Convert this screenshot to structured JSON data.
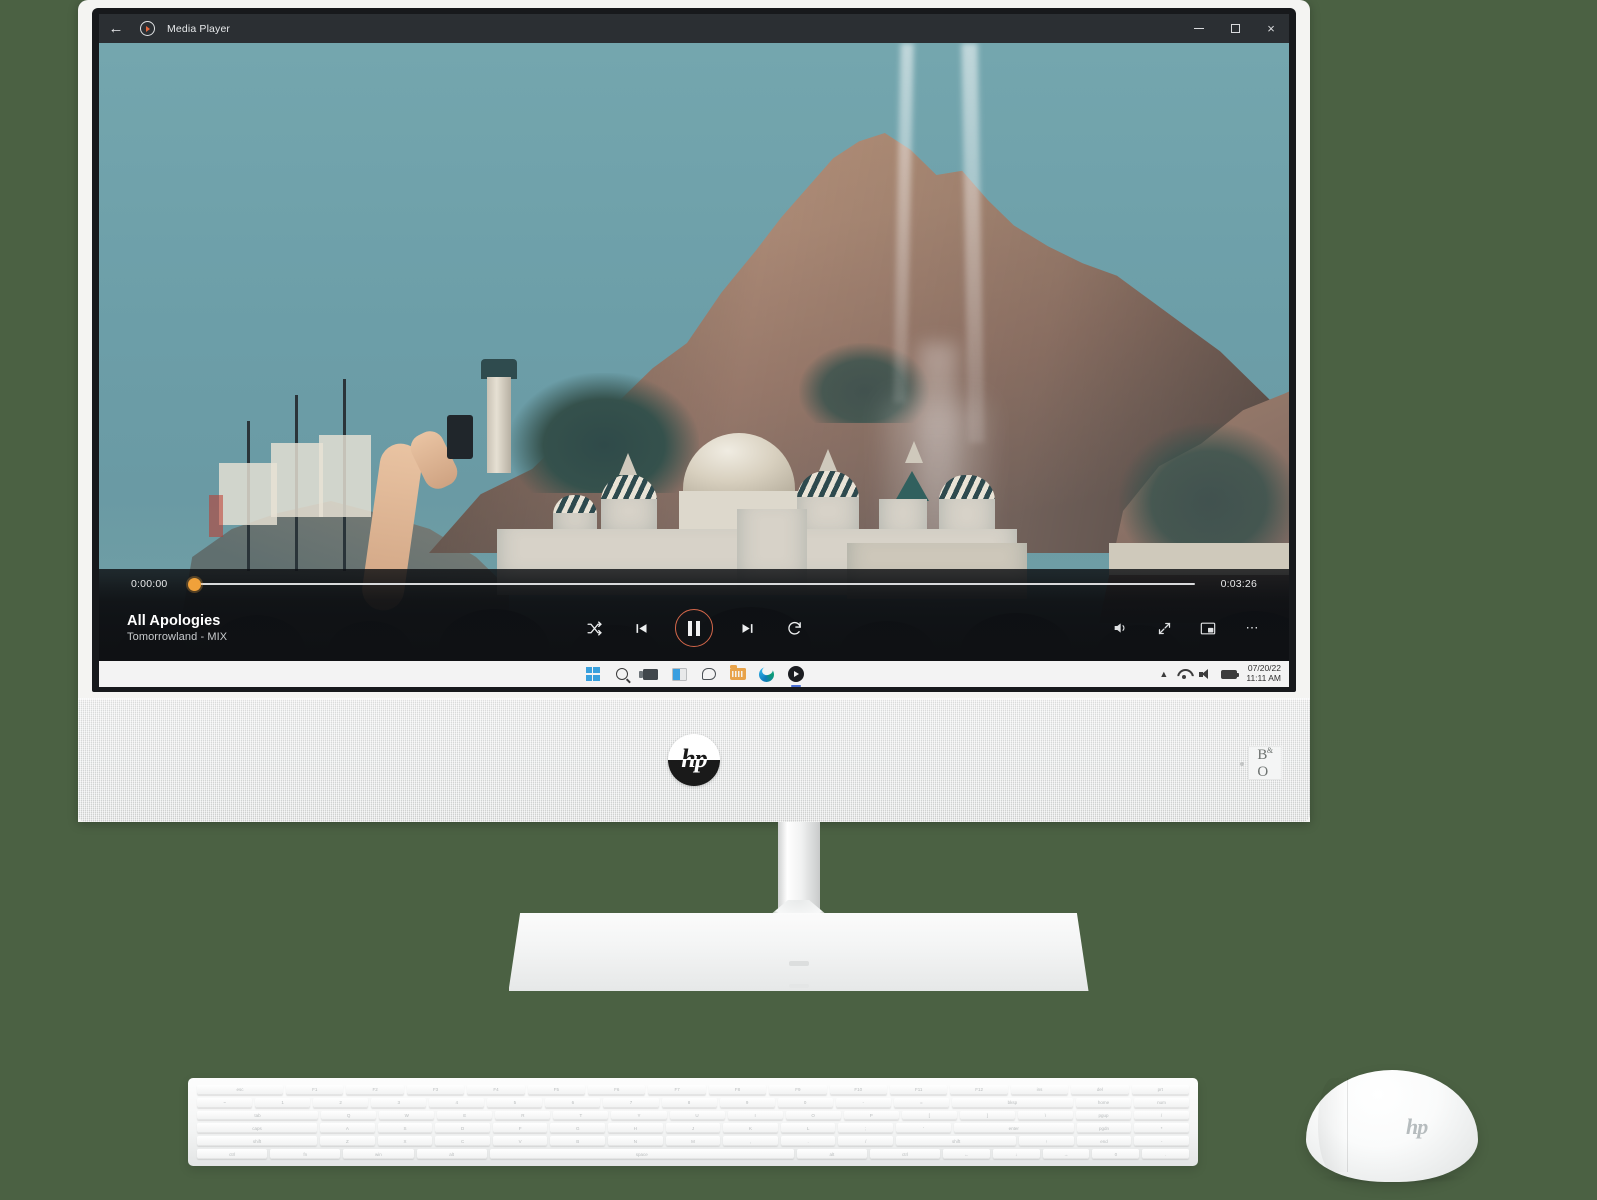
{
  "window": {
    "app_title": "Media Player",
    "back_icon": "back-arrow-icon",
    "app_icon": "media-player-logo-icon",
    "minimize_label": "",
    "maximize_label": "",
    "close_label": "×"
  },
  "player": {
    "elapsed_time": "0:00:00",
    "total_time": "0:03:26",
    "progress_percent": 0,
    "track_title": "All Apologies",
    "track_subtitle": "Tomorrowland - MIX",
    "shuffle_icon": "shuffle-icon",
    "previous_icon": "previous-track-icon",
    "play_pause_state": "pause",
    "next_icon": "next-track-icon",
    "repeat_icon": "repeat-icon",
    "volume_icon": "volume-icon",
    "fullscreen_icon": "fullscreen-icon",
    "miniplayer_icon": "mini-player-icon",
    "more_icon": "more-options-icon",
    "accent_color": "#f0a13a",
    "play_ring_color": "#d4674a"
  },
  "taskbar": {
    "items": [
      {
        "name": "start-button",
        "icon": "windows-logo-icon",
        "active": false
      },
      {
        "name": "search-button",
        "icon": "search-icon",
        "active": false
      },
      {
        "name": "task-view-button",
        "icon": "task-view-icon",
        "active": false
      },
      {
        "name": "widgets-button",
        "icon": "widgets-icon",
        "active": false
      },
      {
        "name": "chat-button",
        "icon": "chat-icon",
        "active": false
      },
      {
        "name": "file-explorer-button",
        "icon": "folder-icon",
        "active": false
      },
      {
        "name": "edge-button",
        "icon": "edge-browser-icon",
        "active": false
      },
      {
        "name": "media-player-button",
        "icon": "media-player-icon",
        "active": true
      }
    ],
    "tray": {
      "overflow_icon": "chevron-up-icon",
      "network_icon": "wifi-icon",
      "volume_icon": "speaker-icon",
      "battery_icon": "battery-icon",
      "date": "07/20/22",
      "time": "11:11 AM"
    }
  },
  "hardware": {
    "brand_logo": "hp",
    "audio_brand_line1": "B",
    "audio_brand_amp": "&",
    "audio_brand_line2": "O",
    "mouse_logo": "hp",
    "chassis_color": "#f4f4f2",
    "speaker_fabric_color": "#e6e8e8",
    "background_color": "#4b6143"
  },
  "keyboard": {
    "rows": [
      [
        "esc",
        "F1",
        "F2",
        "F3",
        "F4",
        "F5",
        "F6",
        "F7",
        "F8",
        "F9",
        "F10",
        "F11",
        "F12",
        "ins",
        "del",
        "prt"
      ],
      [
        "~",
        "1",
        "2",
        "3",
        "4",
        "5",
        "6",
        "7",
        "8",
        "9",
        "0",
        "-",
        "=",
        "bksp",
        "home",
        "num"
      ],
      [
        "tab",
        "Q",
        "W",
        "E",
        "R",
        "T",
        "Y",
        "U",
        "I",
        "O",
        "P",
        "[",
        "]",
        "\\",
        "pgup",
        "/"
      ],
      [
        "caps",
        "A",
        "S",
        "D",
        "F",
        "G",
        "H",
        "J",
        "K",
        "L",
        ";",
        "'",
        "enter",
        "pgdn",
        "*"
      ],
      [
        "shift",
        "Z",
        "X",
        "C",
        "V",
        "B",
        "N",
        "M",
        ",",
        ".",
        "/",
        "shift",
        "↑",
        "end",
        "-"
      ],
      [
        "ctrl",
        "fn",
        "win",
        "alt",
        "space",
        "alt",
        "ctrl",
        "←",
        "↓",
        "→",
        "0",
        "."
      ]
    ]
  }
}
